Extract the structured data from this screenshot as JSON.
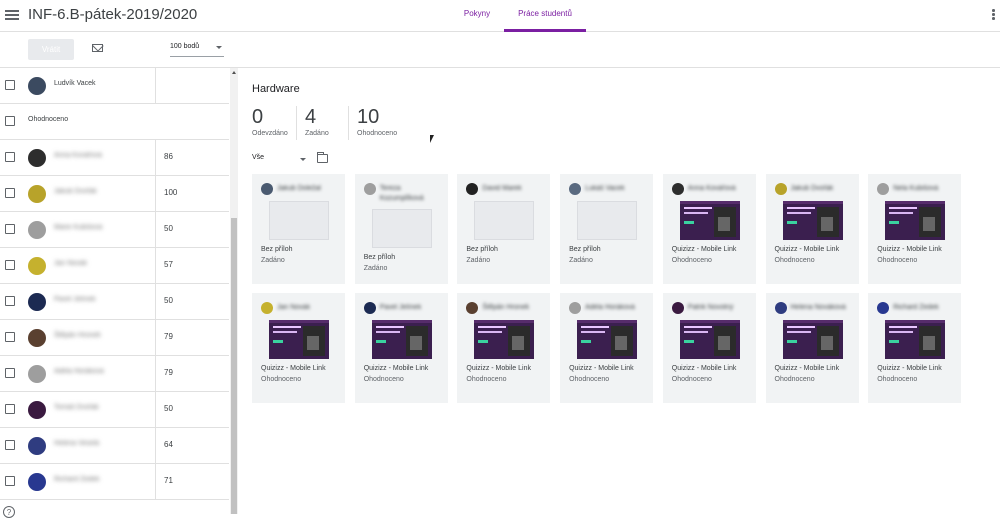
{
  "app": {
    "title": "INF-6.B-pátek-2019/2020"
  },
  "tabs": [
    {
      "label": "Pokyny"
    },
    {
      "label": "Práce studentů"
    }
  ],
  "toolbar": {
    "return_label": "Vrátit",
    "points": "100 bodů"
  },
  "students": [
    {
      "name": "Ludvík Vacek",
      "score": "",
      "blur": false,
      "avatar_color": "#3b4a60"
    },
    {
      "header": "Ohodnoceno"
    },
    {
      "name": "Anna Kovářová",
      "score": "86",
      "blur": true,
      "avatar_color": "#2d2d2d"
    },
    {
      "name": "Jakub Dvořák",
      "score": "100",
      "blur": true,
      "avatar_color": "#b8a32a"
    },
    {
      "name": "Marie Kubišová",
      "score": "50",
      "blur": true,
      "avatar_color": "#9e9e9e"
    },
    {
      "name": "Jan Novák",
      "score": "57",
      "blur": true,
      "avatar_color": "#c5b12e"
    },
    {
      "name": "Pavel Jelínek",
      "score": "50",
      "blur": true,
      "avatar_color": "#1c2a52"
    },
    {
      "name": "Štěpán Hronek",
      "score": "79",
      "blur": true,
      "avatar_color": "#5a4030"
    },
    {
      "name": "Adéla Horáková",
      "score": "79",
      "blur": true,
      "avatar_color": "#9e9e9e"
    },
    {
      "name": "Tomáš Dvořák",
      "score": "50",
      "blur": true,
      "avatar_color": "#3a1a40"
    },
    {
      "name": "Helena Veselá",
      "score": "64",
      "blur": true,
      "avatar_color": "#2f3c80"
    },
    {
      "name": "Richard Zedek",
      "score": "71",
      "blur": true,
      "avatar_color": "#283890"
    }
  ],
  "assignment": {
    "title": "Hardware",
    "stats": [
      {
        "value": "0",
        "label": "Odevzdáno"
      },
      {
        "value": "4",
        "label": "Zadáno"
      },
      {
        "value": "10",
        "label": "Ohodnoceno"
      }
    ],
    "filter": "Vše"
  },
  "cards": [
    {
      "name": "Jakub Doležal",
      "blur": true,
      "thumb": false,
      "l1": "Bez příloh",
      "l2": "Zadáno",
      "avatar_color": "#4a5a70"
    },
    {
      "name": "Tereza Kozumplíková",
      "blur": true,
      "thumb": false,
      "l1": "Bez příloh",
      "l2": "Zadáno",
      "avatar_color": "#9e9e9e"
    },
    {
      "name": "David Marek",
      "blur": true,
      "thumb": false,
      "l1": "Bez příloh",
      "l2": "Zadáno",
      "avatar_color": "#222222"
    },
    {
      "name": "Lukáš Vacek",
      "blur": true,
      "thumb": false,
      "l1": "Bez příloh",
      "l2": "Zadáno",
      "avatar_color": "#5a6a80"
    },
    {
      "name": "Anna Kovářová",
      "blur": true,
      "thumb": true,
      "l1": "Quizizz - Mobile Link",
      "l2": "Ohodnoceno",
      "avatar_color": "#2d2d2d"
    },
    {
      "name": "Jakub Dvořák",
      "blur": true,
      "thumb": true,
      "l1": "Quizizz - Mobile Link",
      "l2": "Ohodnoceno",
      "avatar_color": "#b8a32a"
    },
    {
      "name": "Nela Kubišová",
      "blur": true,
      "thumb": true,
      "l1": "Quizizz - Mobile Link",
      "l2": "Ohodnoceno",
      "avatar_color": "#9e9e9e"
    },
    {
      "name": "Jan Novák",
      "blur": true,
      "thumb": true,
      "l1": "Quizizz - Mobile Link",
      "l2": "Ohodnoceno",
      "avatar_color": "#c5b12e"
    },
    {
      "name": "Pavel Jelínek",
      "blur": true,
      "thumb": true,
      "l1": "Quizizz - Mobile Link",
      "l2": "Ohodnoceno",
      "avatar_color": "#1c2a52"
    },
    {
      "name": "Štěpán Hronek",
      "blur": true,
      "thumb": true,
      "l1": "Quizizz - Mobile Link",
      "l2": "Ohodnoceno",
      "avatar_color": "#5a4030"
    },
    {
      "name": "Adéla Horáková",
      "blur": true,
      "thumb": true,
      "l1": "Quizizz - Mobile Link",
      "l2": "Ohodnoceno",
      "avatar_color": "#9e9e9e"
    },
    {
      "name": "Patrik Novotný",
      "blur": true,
      "thumb": true,
      "l1": "Quizizz - Mobile Link",
      "l2": "Ohodnoceno",
      "avatar_color": "#3a1a40"
    },
    {
      "name": "Helena Nováková",
      "blur": true,
      "thumb": true,
      "l1": "Quizizz - Mobile Link",
      "l2": "Ohodnoceno",
      "avatar_color": "#2f3c80"
    },
    {
      "name": "Richard Zedek",
      "blur": true,
      "thumb": true,
      "l1": "Quizizz - Mobile Link",
      "l2": "Ohodnoceno",
      "avatar_color": "#283890"
    }
  ],
  "colors": {
    "accent": "#7b1fa2",
    "card_bg": "#f1f3f4"
  }
}
